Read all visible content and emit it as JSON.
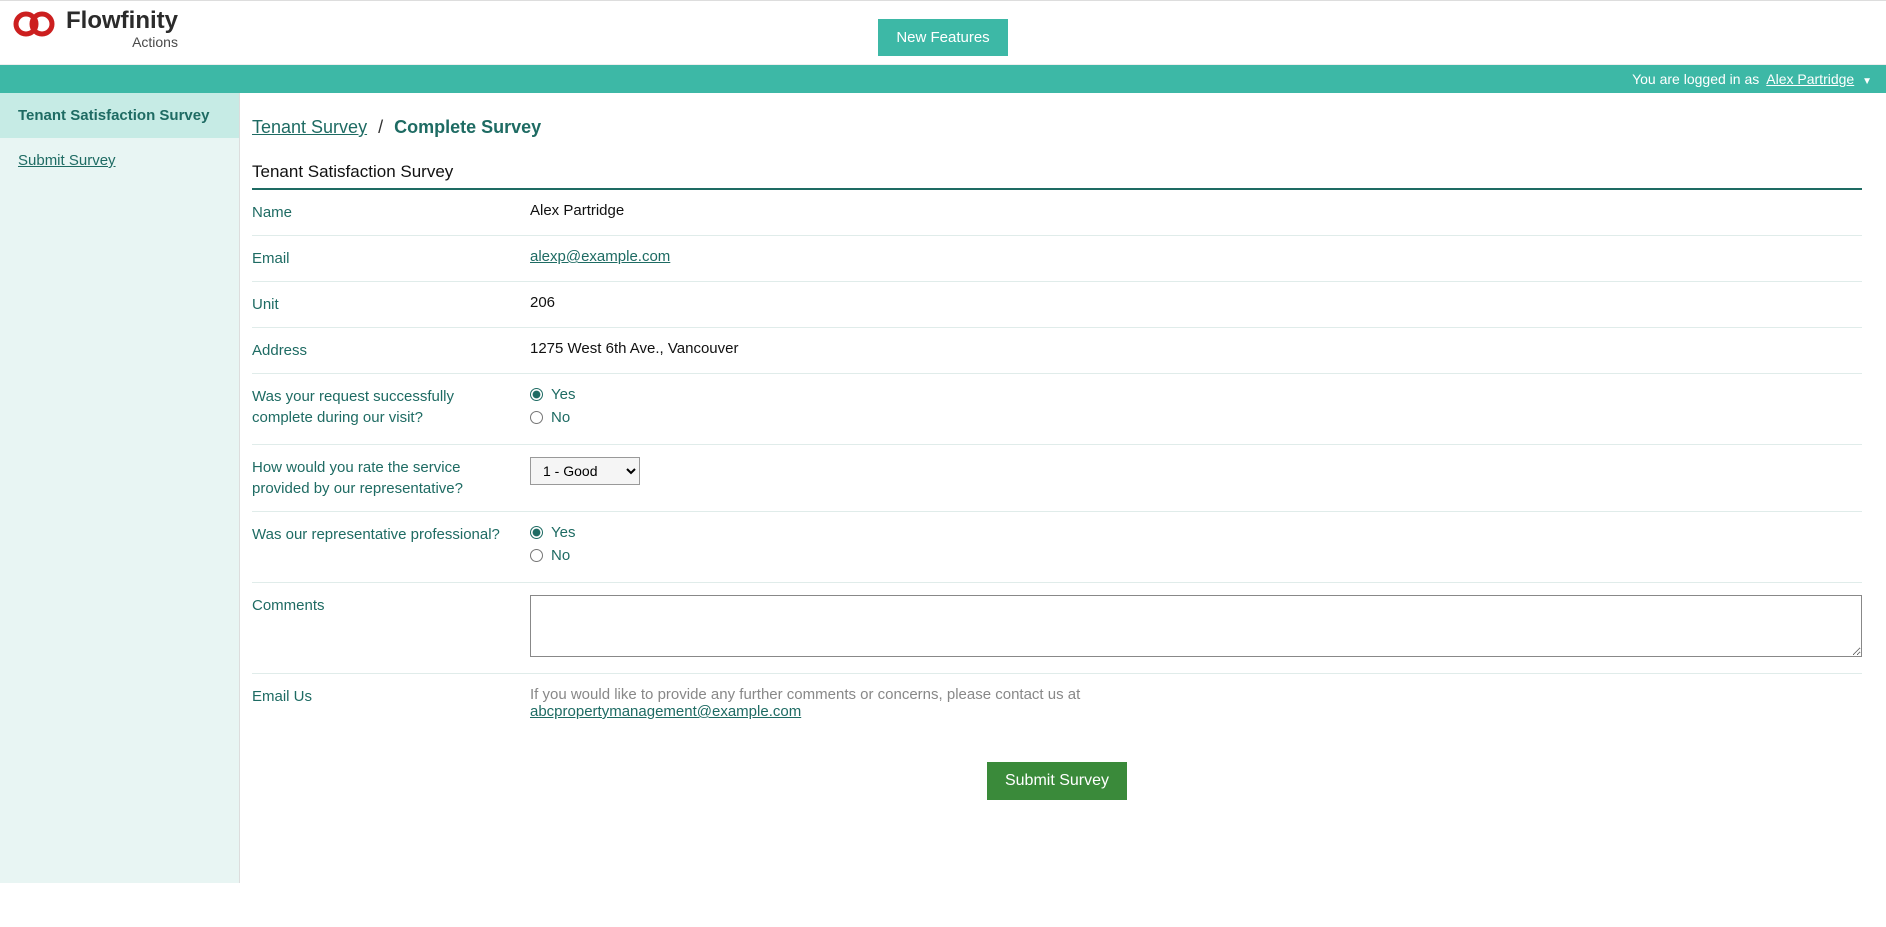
{
  "header": {
    "brand": "Flowfinity",
    "subtitle": "Actions",
    "new_features": "New Features"
  },
  "login_bar": {
    "prefix": "You are logged in as",
    "user": "Alex Partridge"
  },
  "sidebar": {
    "header": "Tenant Satisfaction Survey",
    "items": [
      {
        "label": "Submit Survey"
      }
    ]
  },
  "breadcrumb": {
    "parent": "Tenant Survey",
    "current": "Complete Survey"
  },
  "section_title": "Tenant Satisfaction Survey",
  "form": {
    "name": {
      "label": "Name",
      "value": "Alex Partridge"
    },
    "email": {
      "label": "Email",
      "value": "alexp@example.com"
    },
    "unit": {
      "label": "Unit",
      "value": "206"
    },
    "address": {
      "label": "Address",
      "value": "1275 West 6th Ave., Vancouver"
    },
    "request_complete": {
      "label": "Was your request successfully complete during our visit?",
      "options": {
        "yes": "Yes",
        "no": "No"
      },
      "selected": "yes"
    },
    "rating": {
      "label": "How would you rate the service provided by our representative?",
      "selected": "1 - Good"
    },
    "professional": {
      "label": "Was our representative professional?",
      "options": {
        "yes": "Yes",
        "no": "No"
      },
      "selected": "yes"
    },
    "comments": {
      "label": "Comments",
      "value": ""
    },
    "emailus": {
      "label": "Email Us",
      "text": "If you would like to provide any further comments or concerns, please contact us at",
      "link": "abcpropertymanagement@example.com"
    },
    "submit": "Submit Survey"
  }
}
